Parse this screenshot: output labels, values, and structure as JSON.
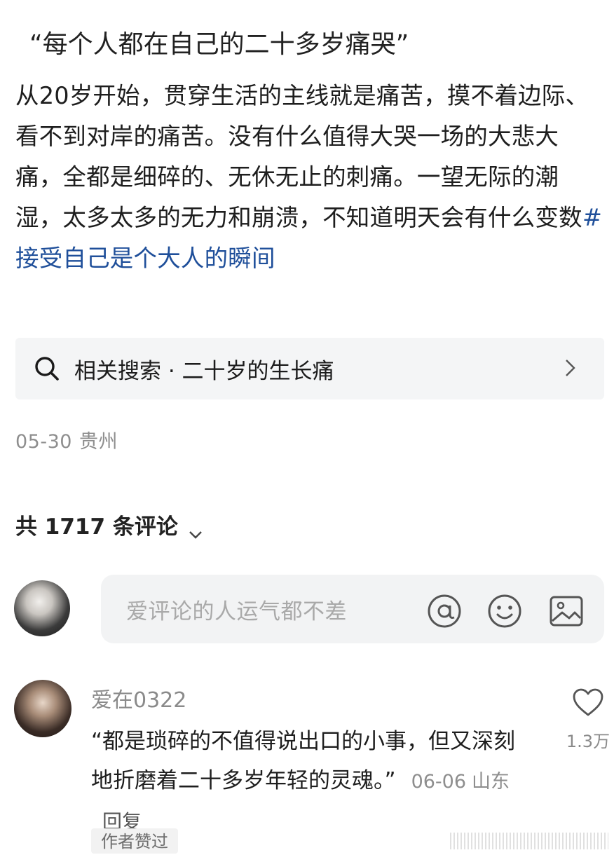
{
  "post": {
    "title": "“每个人都在自己的二十多岁痛哭”",
    "body": "从20岁开始，贯穿生活的主线就是痛苦，摸不着边际、看不到对岸的痛苦。没有什么值得大哭一场的大悲大痛，全都是细碎的、无休无止的刺痛。一望无际的潮湿，太多太多的无力和崩溃，不知道明天会有什么变数",
    "hashtag": "#接受自己是个大人的瞬间",
    "date": "05-30",
    "location": "贵州"
  },
  "related_search": {
    "label": "相关搜索 · 二十岁的生长痛",
    "icon": "search-icon"
  },
  "comments_header": {
    "count_text": "共 1717 条评论"
  },
  "comment_input": {
    "placeholder": "爱评论的人运气都不差",
    "icons": [
      "at-icon",
      "emoji-icon",
      "image-icon"
    ]
  },
  "comments": [
    {
      "username": "爱在0322",
      "text": "“都是琐碎的不值得说出口的小事，但又深刻地折磨着二十多岁年轻的灵魂。”",
      "date": "06-06",
      "location": "山东",
      "reply_label": "回复",
      "likes": "1.3万",
      "badge": "作者赞过"
    }
  ],
  "colors": {
    "hashtag": "#1f4f9a",
    "muted": "#8e8e8e",
    "input_bg": "#f2f3f4"
  }
}
